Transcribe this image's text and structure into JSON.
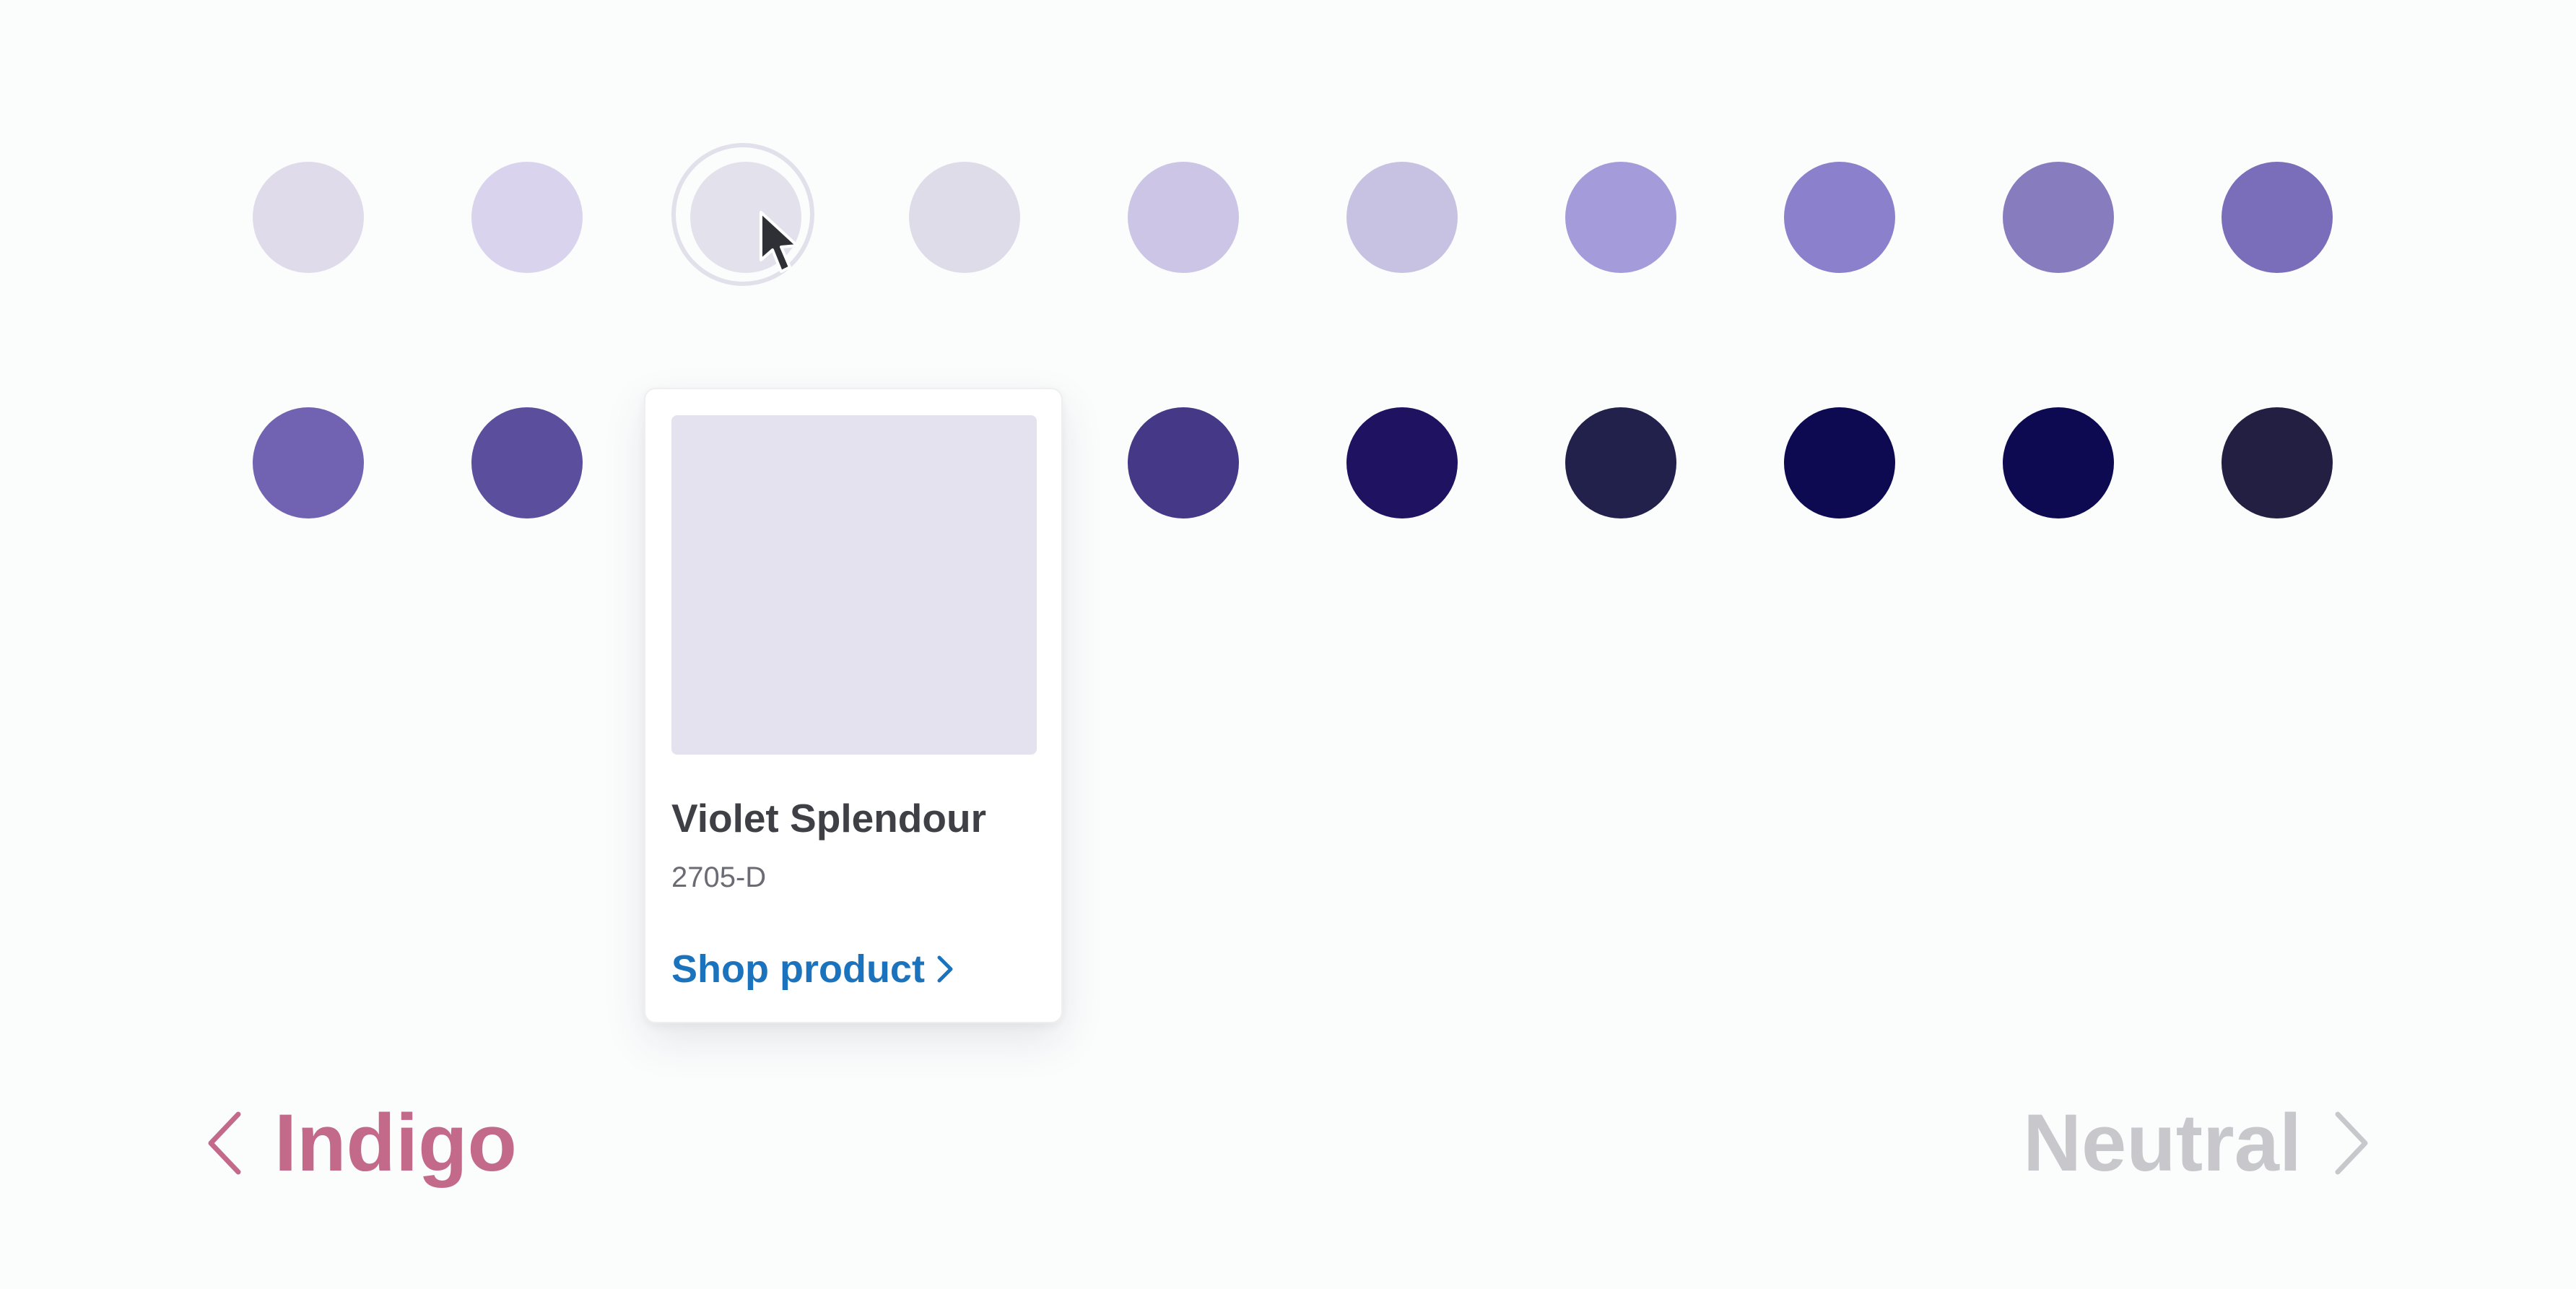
{
  "palette": {
    "row1": [
      {
        "color": "#dfdbea",
        "state": "default"
      },
      {
        "color": "#d9d3ee",
        "state": "default"
      },
      {
        "color": "#e3e1ec",
        "state": "hovered"
      },
      {
        "color": "#dfdcea",
        "state": "default"
      },
      {
        "color": "#ccc5e6",
        "state": "default"
      },
      {
        "color": "#c8c2e2",
        "state": "default"
      },
      {
        "color": "#a49bdb",
        "state": "default"
      },
      {
        "color": "#8b80cc",
        "state": "default"
      },
      {
        "color": "#877cbe",
        "state": "default"
      },
      {
        "color": "#7a6dba",
        "state": "default"
      }
    ],
    "row2": [
      {
        "color": "#7263b2",
        "state": "default"
      },
      {
        "color": "#5a4e9d",
        "state": "default"
      },
      {
        "color": "#584b96",
        "state": "covered"
      },
      {
        "color": "#4e428c",
        "state": "covered"
      },
      {
        "color": "#453886",
        "state": "default"
      },
      {
        "color": "#1f1260",
        "state": "default"
      },
      {
        "color": "#22214c",
        "state": "default"
      },
      {
        "color": "#0d0a52",
        "state": "default"
      },
      {
        "color": "#0d0a52",
        "state": "default"
      },
      {
        "color": "#231f42",
        "state": "default"
      }
    ]
  },
  "product_card": {
    "image_color": "#e4e2ee",
    "name": "Violet Splendour",
    "code": "2705-D",
    "shop_link_label": "Shop product",
    "shop_link_color": "#1c73bd"
  },
  "navigation": {
    "prev": {
      "label": "Indigo",
      "color": "#c36a8a",
      "icon": "chevron-left-icon"
    },
    "next": {
      "label": "Neutral",
      "color": "#c8c7cc",
      "icon": "chevron-right-icon"
    }
  },
  "cursor": {
    "icon": "mouse-pointer-icon"
  }
}
